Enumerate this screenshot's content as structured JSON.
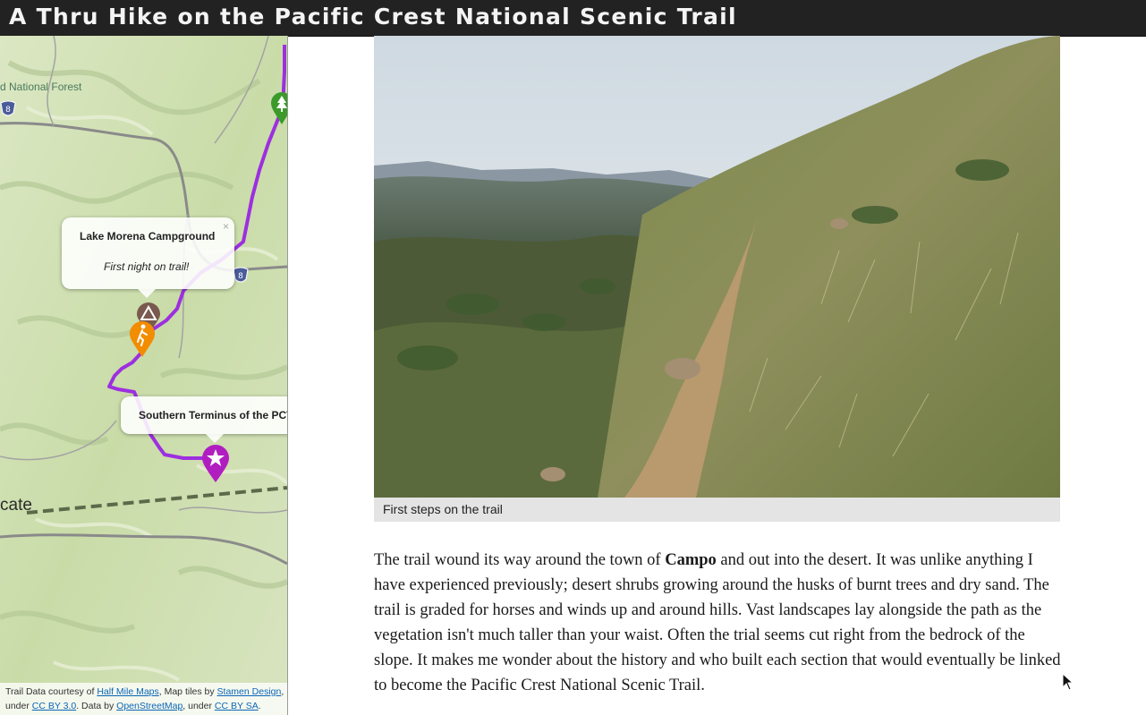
{
  "header": {
    "title": "A Thru Hike on the Pacific Crest National Scenic Trail"
  },
  "map": {
    "labels": {
      "forest": "d National Forest",
      "town": "cate"
    },
    "highway_shield": "8",
    "popups": [
      {
        "title": "Lake Morena Campground",
        "note": "First night on trail!",
        "close": "×"
      },
      {
        "title": "Southern Terminus of the PCT"
      }
    ],
    "markers": [
      {
        "icon": "tree-icon",
        "color": "#3c9a2b"
      },
      {
        "icon": "campground-icon",
        "color": "#7a5a4e"
      },
      {
        "icon": "hiker-icon",
        "color": "#f28c00"
      },
      {
        "icon": "star-icon",
        "color": "#b11ec0"
      }
    ],
    "trail_color": "#9d2fe0",
    "attribution": {
      "prefix": "Trail Data courtesy of ",
      "half_mile": "Half Mile Maps",
      "tiles_text": ", Map tiles by ",
      "stamen": "Stamen Design",
      "under1": ", under ",
      "ccby": "CC BY 3.0",
      "data_by": ". Data by ",
      "osm": "OpenStreetMap",
      "under2": ", under ",
      "ccbysa": "CC BY SA",
      "end": "."
    }
  },
  "figure": {
    "caption": "First steps on the trail"
  },
  "article": {
    "text_before": "The trail wound its way around the town of ",
    "bold": "Campo",
    "text_after": " and out into the desert.  It was unlike anything I have experienced previously; desert shrubs growing around the husks of burnt trees and dry sand.  The trail is graded for horses and winds up and around hills.  Vast landscapes lay alongside the path as the vegetation isn't much taller than your waist. Often the trial seems cut right from the bedrock of the slope.  It makes me wonder about the history and who built each section that would eventually be linked to become the Pacific Crest National Scenic Trail."
  }
}
